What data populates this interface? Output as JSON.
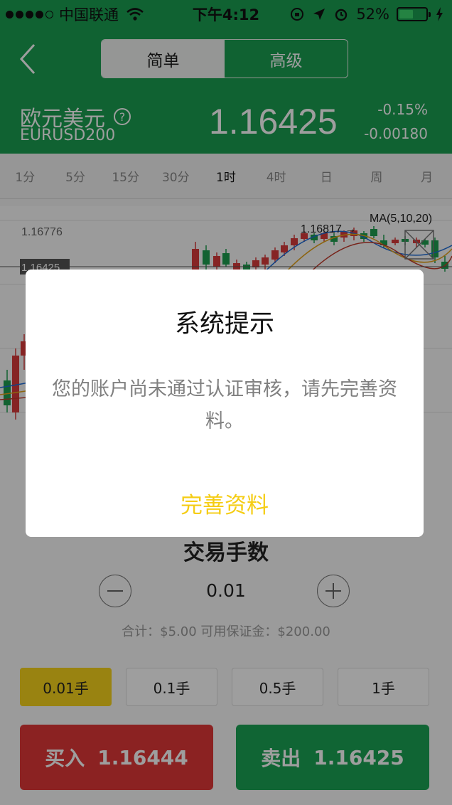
{
  "status_bar": {
    "carrier": "中国联通",
    "time": "下午4:12",
    "battery_percent_text": "52%",
    "battery_level": 0.52
  },
  "nav": {
    "tabs": [
      {
        "label": "简单",
        "active": true
      },
      {
        "label": "高级",
        "active": false
      }
    ]
  },
  "quote": {
    "name": "欧元美元",
    "help_symbol": "?",
    "code": "EURUSD200",
    "price": "1.16425",
    "change_percent": "-0.15%",
    "change": "-0.00180"
  },
  "timeframes": [
    {
      "label": "1分",
      "active": false
    },
    {
      "label": "5分",
      "active": false
    },
    {
      "label": "15分",
      "active": false
    },
    {
      "label": "30分",
      "active": false
    },
    {
      "label": "1时",
      "active": true
    },
    {
      "label": "4时",
      "active": false
    },
    {
      "label": "日",
      "active": false
    },
    {
      "label": "周",
      "active": false
    },
    {
      "label": "月",
      "active": false
    }
  ],
  "chart": {
    "ma_label": "MA(5,10,20)",
    "price_high": "1.16776",
    "current_label": "1.16425",
    "peak_label": "1.16817 →"
  },
  "trade": {
    "title": "交易手数",
    "quantity": "0.01",
    "totals": "合计：$5.00   可用保证金：$200.00",
    "lots": [
      {
        "label": "0.01手",
        "active": true
      },
      {
        "label": "0.1手",
        "active": false
      },
      {
        "label": "0.5手",
        "active": false
      },
      {
        "label": "1手",
        "active": false
      }
    ],
    "buy": {
      "label": "买入",
      "price": "1.16444"
    },
    "sell": {
      "label": "卖出",
      "price": "1.16425"
    }
  },
  "dialog": {
    "title": "系统提示",
    "message": "您的账户尚未通过认证审核，请先完善资料。",
    "action": "完善资料"
  },
  "colors": {
    "brand_green": "#1a9e52",
    "buy_red": "#e03838",
    "sell_green": "#1aa355",
    "accent_yellow": "#f7d41c"
  }
}
